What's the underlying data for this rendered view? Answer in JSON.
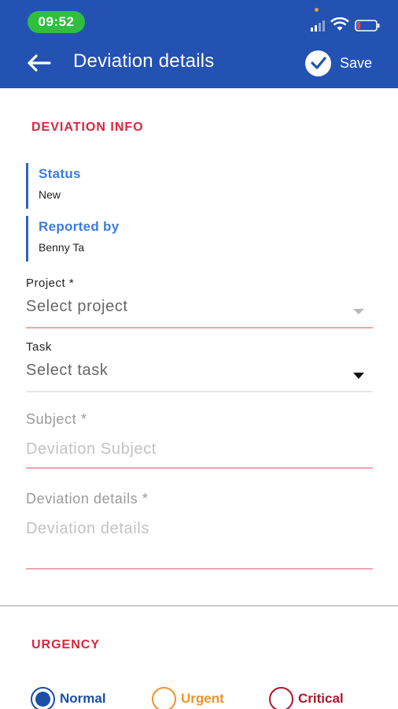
{
  "status_bar": {
    "time": "09:52",
    "accent": "#2fbf3f"
  },
  "header": {
    "title": "Deviation details",
    "save_label": "Save",
    "background": "#2352b3",
    "back_icon": "arrow-left-icon",
    "save_icon": "check-circle-icon"
  },
  "deviation_info": {
    "heading": "DEVIATION INFO",
    "status": {
      "label": "Status",
      "value": "New"
    },
    "reported_by": {
      "label": "Reported by",
      "value": "Benny Ta"
    }
  },
  "form": {
    "project": {
      "label": "Project *",
      "value": "Select project"
    },
    "task": {
      "label": "Task",
      "value": "Select task"
    },
    "subject": {
      "label": "Subject *",
      "placeholder": "Deviation Subject"
    },
    "details": {
      "label": "Deviation details *",
      "placeholder": "Deviation details"
    }
  },
  "urgency": {
    "heading": "URGENCY",
    "selected": "Normal",
    "options": [
      {
        "label": "Normal",
        "color": "#1c4fa8"
      },
      {
        "label": "Urgent",
        "color": "#f0932b"
      },
      {
        "label": "Critical",
        "color": "#b3142c"
      }
    ]
  }
}
